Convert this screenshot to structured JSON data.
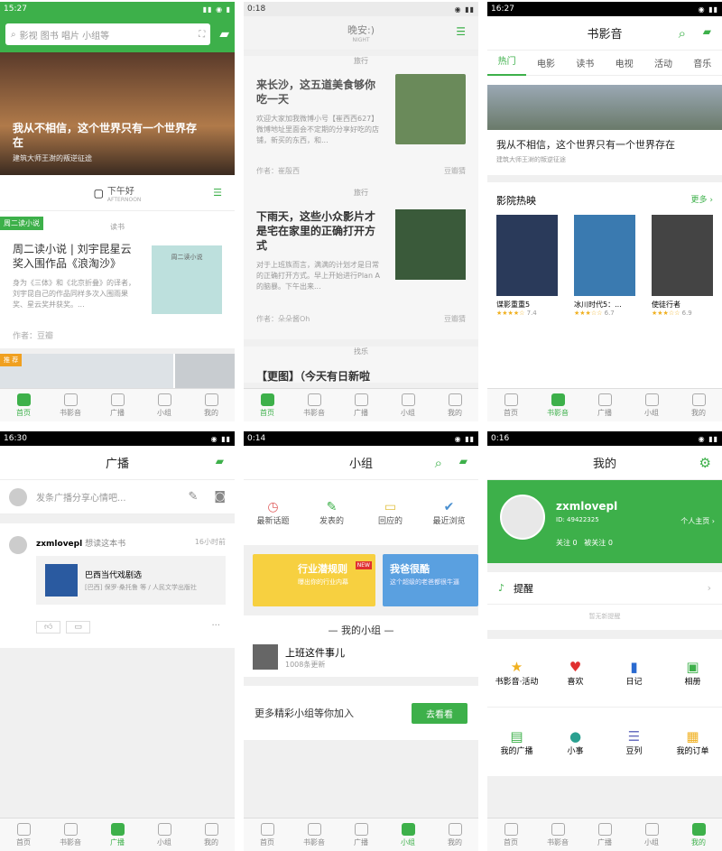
{
  "s1": {
    "time": "15:27",
    "search_ph": "影视 图书 唱片 小组等",
    "hero_title": "我从不相信，这个世界只有一个世界存在",
    "hero_sub": "建筑大师王澍的叛逆征途",
    "greet": "下午好",
    "greet_en": "AFTERNOON",
    "badge": "周二读小说",
    "cat": "读书",
    "article_title": "周二读小说 | 刘宇昆星云奖入围作品《浪淘沙》",
    "article_body": "身为《三体》和《北京折叠》的译者，刘宇昆自己的作品同样多次入围雨果奖、星云奖并获奖。...",
    "author": "作者：豆瓣",
    "badge2": "推 荐",
    "book_tag": "周二读小说"
  },
  "s2": {
    "time": "0:18",
    "logo": "晚安:)",
    "logo_en": "NIGHT",
    "cap": "旅行",
    "c1_title": "来长沙，这五道美食够你吃一天",
    "c1_body": "欢迎大家加我微博小号【崔西西627】微博地址里面会不定期的分享好吃的店铺，新买的东西，和...",
    "c1_author": "作者：崔殷西",
    "c1_src": "豆瓣猜",
    "c2_title": "下雨天，这些小众影片才是宅在家里的正确打开方式",
    "c2_body": "对于上班族而言，满满的计划才是日常的正确打开方式。早上开始进行Plan A的脑暴。下午出来...",
    "c2_author": "作者：朵朵酱Oh",
    "c2_src": "豆瓣猜",
    "cap3": "找乐",
    "c3_title": "【更图】（今天有日新啦"
  },
  "s3": {
    "time": "16:27",
    "title": "书影音",
    "tabs": [
      "热门",
      "电影",
      "读书",
      "电视",
      "活动",
      "音乐"
    ],
    "hero_title": "我从不相信，这个世界只有一个世界存在",
    "hero_sub": "建筑大师王澍的叛逆征途",
    "section": "影院热映",
    "more": "更多 ›",
    "movies": [
      {
        "name": "谍影重重5",
        "rating": "7.4",
        "stars": 4
      },
      {
        "name": "冰川时代5：...",
        "rating": "6.7",
        "stars": 3.5
      },
      {
        "name": "使徒行者",
        "rating": "6.9",
        "stars": 3.5
      }
    ]
  },
  "s4": {
    "time": "16:30",
    "title": "广播",
    "ph": "发条广播分享心情吧...",
    "user": "zxmlovepl",
    "action": "想读这本书",
    "when": "16小时前",
    "book_title": "巴西当代戏剧选",
    "book_meta": "[巴西] 保罗·桑托鲁 等 / 人民文学出版社"
  },
  "s5": {
    "time": "0:14",
    "title": "小组",
    "quick": [
      "最新话题",
      "发表的",
      "回应的",
      "最近浏览"
    ],
    "banner1": "行业潜规则",
    "banner1_badge": "NEW",
    "banner1_sub": "曝出你的行业内幕",
    "banner2": "我爸很酷",
    "banner2_sub": "这个超级的老爸都很牛逼",
    "my_groups": "— 我的小组 —",
    "group_name": "上班这件事儿",
    "group_count": "1008条更新",
    "more_text": "更多精彩小组等你加入",
    "go": "去看看"
  },
  "s6": {
    "time": "0:16",
    "title": "我的",
    "user": "zxmlovepl",
    "uid": "ID: 49422325",
    "home": "个人主页 ›",
    "follow": "关注 0",
    "followers": "被关注 0",
    "remind": "提醒",
    "no_remind": "暂无新提醒",
    "grid1": [
      "书影音·活动",
      "喜欢",
      "日记",
      "相册"
    ],
    "grid2": [
      "我的广播",
      "小事",
      "豆列",
      "我的订单"
    ]
  },
  "tabs": [
    "首页",
    "书影音",
    "广播",
    "小组",
    "我的"
  ],
  "colors": {
    "green": "#3db04a"
  }
}
